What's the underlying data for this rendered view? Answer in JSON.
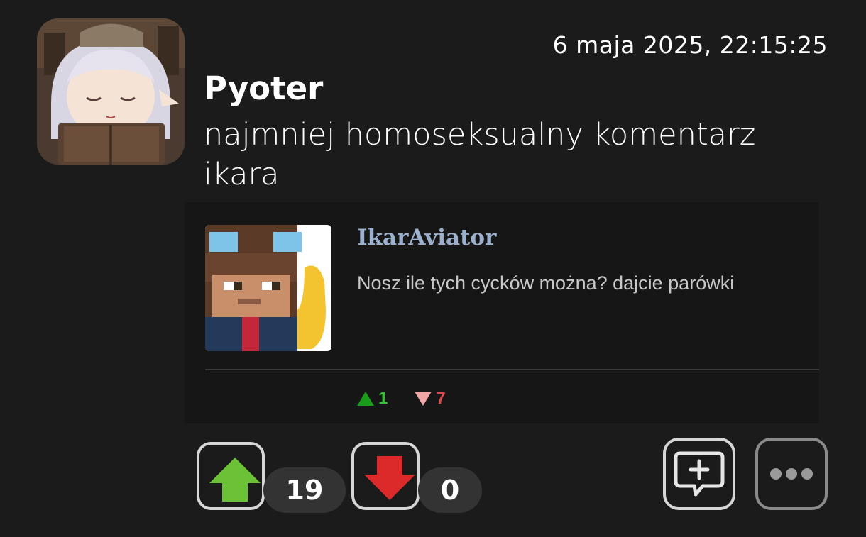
{
  "post": {
    "timestamp": "6 maja 2025, 22:15:25",
    "author": "Pyoter",
    "avatar_icon": "anime-girl-reading-avatar",
    "text": "najmniej homoseksualny komentarz ikara"
  },
  "embed": {
    "author": "IkarAviator",
    "avatar_icon": "minecraft-character-thumbs-up-avatar",
    "text": "Nosz ile tych cycków można? dajcie parówki",
    "upvotes": "1",
    "downvotes": "7"
  },
  "actions": {
    "upvote_icon": "green-up-arrow-icon",
    "upvote_count": "19",
    "downvote_icon": "red-down-arrow-icon",
    "downvote_count": "0",
    "reply_icon": "add-comment-icon",
    "more_icon": "more-dots-icon"
  },
  "colors": {
    "background": "#1b1b1b",
    "upvote": "#6cc236",
    "downvote": "#dc2a2a",
    "embed_author": "#9bb0cc"
  }
}
